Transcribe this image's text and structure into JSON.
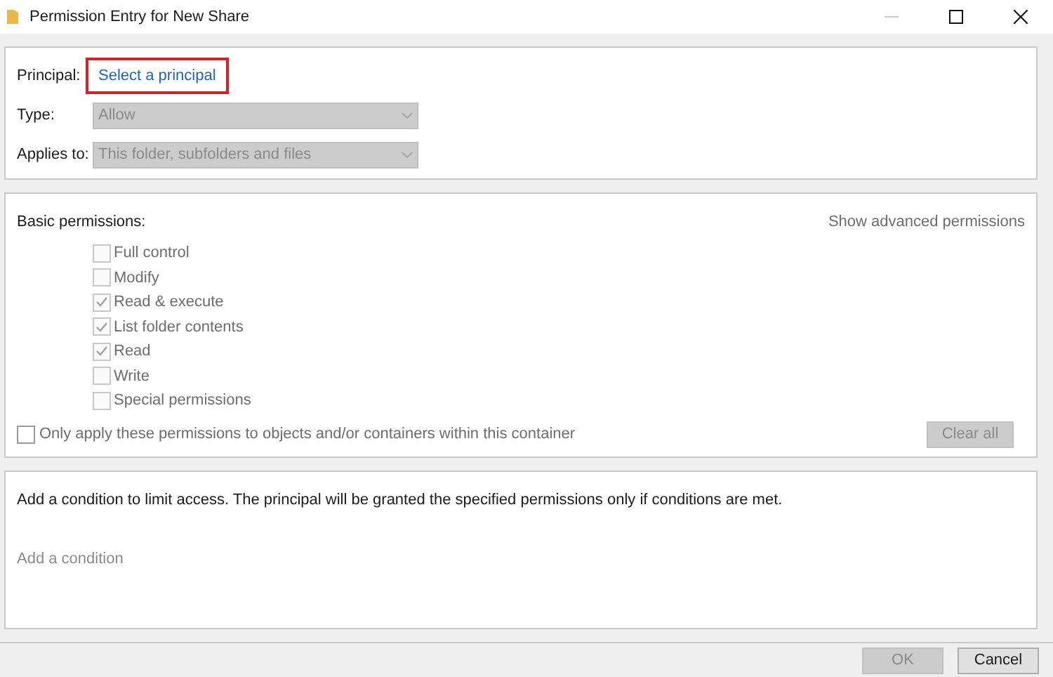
{
  "window": {
    "title": "Permission Entry for New Share"
  },
  "principal": {
    "label": "Principal:",
    "link": "Select a principal",
    "highlighted": true
  },
  "fields": [
    {
      "label": "Type:",
      "value": "Allow",
      "disabled": true
    },
    {
      "label": "Applies to:",
      "value": "This folder, subfolders and files",
      "disabled": true
    }
  ],
  "permissions": {
    "heading": "Basic permissions:",
    "advanced_link": "Show advanced permissions",
    "items": [
      {
        "label": "Full control",
        "checked": false,
        "disabled": true
      },
      {
        "label": "Modify",
        "checked": false,
        "disabled": true
      },
      {
        "label": "Read & execute",
        "checked": true,
        "disabled": true
      },
      {
        "label": "List folder contents",
        "checked": true,
        "disabled": true
      },
      {
        "label": "Read",
        "checked": true,
        "disabled": true
      },
      {
        "label": "Write",
        "checked": false,
        "disabled": true
      },
      {
        "label": "Special permissions",
        "checked": false,
        "disabled": true
      }
    ],
    "only_apply": {
      "label": "Only apply these permissions to objects and/or containers within this container",
      "checked": false,
      "disabled": false
    },
    "clear_button": {
      "label": "Clear all",
      "disabled": true
    }
  },
  "conditions": {
    "text": "Add a condition to limit access. The principal will be granted the specified permissions only if conditions are met.",
    "add_link": "Add a condition"
  },
  "buttons": [
    {
      "label": "OK",
      "disabled": true
    },
    {
      "label": "Cancel",
      "disabled": false
    }
  ]
}
